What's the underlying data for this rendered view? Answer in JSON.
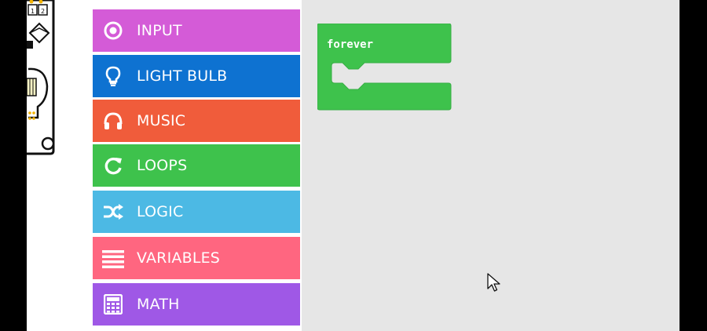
{
  "toolbox": {
    "categories": [
      {
        "label": "INPUT",
        "color": "#d45bd7",
        "icon": "radio-icon"
      },
      {
        "label": "LIGHT BULB",
        "color": "#0e72d1",
        "icon": "lightbulb-icon"
      },
      {
        "label": "MUSIC",
        "color": "#f05c3b",
        "icon": "headphones-icon"
      },
      {
        "label": "LOOPS",
        "color": "#3ec24c",
        "icon": "refresh-icon"
      },
      {
        "label": "LOGIC",
        "color": "#4cb9e4",
        "icon": "shuffle-icon"
      },
      {
        "label": "VARIABLES",
        "color": "#ff6680",
        "icon": "list-icon"
      },
      {
        "label": "MATH",
        "color": "#9f58e6",
        "icon": "calculator-icon"
      }
    ]
  },
  "workspace": {
    "block": {
      "label": "forever",
      "color": "#3ec24c"
    }
  },
  "colors": {
    "workspace_bg": "#e6e6e6",
    "frame": "#000000"
  }
}
